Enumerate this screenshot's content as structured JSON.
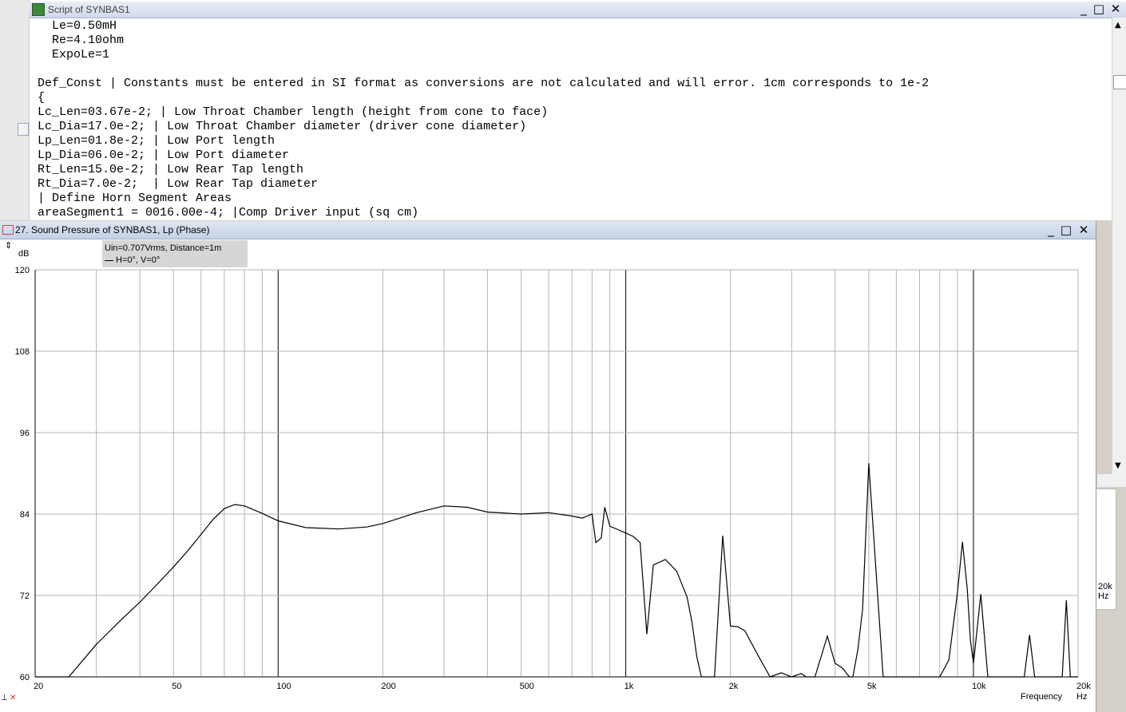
{
  "script_window": {
    "title": "Script of SYNBAS1",
    "lines": [
      "  Le=0.50mH",
      "  Re=4.10ohm",
      "  ExpoLe=1",
      "",
      "Def_Const | Constants must be entered in SI format as conversions are not calculated and will error. 1cm corresponds to 1e-2",
      "{",
      "Lc_Len=03.67e-2; | Low Throat Chamber length (height from cone to face)",
      "Lc_Dia=17.0e-2; | Low Throat Chamber diameter (driver cone diameter)",
      "Lp_Len=01.8e-2; | Low Port length",
      "Lp_Dia=06.0e-2; | Low Port diameter",
      "Rt_Len=15.0e-2; | Low Rear Tap length",
      "Rt_Dia=7.0e-2;  | Low Rear Tap diameter",
      "| Define Horn Segment Areas",
      "areaSegment1 = 0016.00e-4; |Comp Driver input (sq cm)"
    ]
  },
  "behind_window": {
    "axis_label": "20k\nHz"
  },
  "sp_window": {
    "title": "27. Sound Pressure of SYNBAS1, Lp (Phase)",
    "legend_line1": "Uin=0.707Vrms, Distance=1m",
    "legend_line2": "H=0°, V=0°",
    "y_unit": "dB",
    "x_axis_title": "Frequency",
    "x_unit": "Hz"
  },
  "colors": {
    "title_bar": "#cfd9ea",
    "grid_minor": "#b4b4b4",
    "grid_major": "#000000",
    "curve": "#000000",
    "legend_bg": "#d6d6d6"
  },
  "chart_data": {
    "type": "line",
    "x_scale": "log",
    "xlim": [
      20,
      20000
    ],
    "ylim": [
      60,
      120
    ],
    "ylabel": "dB",
    "xlabel": "Frequency",
    "x_unit": "Hz",
    "y_ticks": [
      120,
      108,
      96,
      84,
      72,
      60
    ],
    "x_ticks": [
      {
        "v": 20,
        "label": "20"
      },
      {
        "v": 50,
        "label": "50"
      },
      {
        "v": 100,
        "label": "100"
      },
      {
        "v": 200,
        "label": "200"
      },
      {
        "v": 500,
        "label": "500"
      },
      {
        "v": 1000,
        "label": "1k"
      },
      {
        "v": 2000,
        "label": "2k"
      },
      {
        "v": 5000,
        "label": "5k"
      },
      {
        "v": 10000,
        "label": "10k"
      },
      {
        "v": 20000,
        "label": "20k"
      }
    ],
    "series": [
      {
        "x": [
          20,
          25,
          30,
          35,
          40,
          45,
          50,
          55,
          60,
          65,
          70,
          75,
          80,
          90,
          100,
          120,
          150,
          180,
          200,
          250,
          300,
          350,
          400,
          500,
          600,
          700,
          750,
          800,
          820,
          850,
          870,
          900,
          950,
          1000,
          1050,
          1100,
          1150,
          1200,
          1300,
          1400,
          1500,
          1550,
          1600,
          1650,
          1700,
          1800,
          1900,
          2000,
          2100,
          2200,
          2400,
          2600,
          2800,
          3000,
          3200,
          3300,
          3500,
          3800,
          4000,
          4200,
          4400,
          4500,
          4650,
          4800,
          5000,
          5500,
          6000,
          7000,
          8000,
          8500,
          9000,
          9300,
          9600,
          9800,
          10000,
          10500,
          11000,
          13000,
          14000,
          14500,
          15000,
          17000,
          18000,
          18500,
          19000,
          20000
        ],
        "y": [
          60,
          60,
          64.8,
          68.2,
          71.0,
          73.7,
          76.2,
          78.6,
          81.0,
          83.2,
          84.8,
          85.4,
          85.2,
          84.1,
          83.0,
          82.0,
          81.8,
          82.1,
          82.6,
          84.2,
          85.2,
          85.0,
          84.3,
          84.0,
          84.2,
          83.7,
          83.4,
          84.0,
          79.8,
          80.5,
          85.0,
          82.2,
          81.7,
          81.2,
          80.7,
          79.8,
          66.3,
          76.5,
          77.3,
          75.6,
          71.8,
          68.1,
          63.0,
          60,
          60,
          60,
          80.8,
          67.5,
          67.4,
          66.8,
          63.2,
          60,
          60.6,
          60,
          60.5,
          60,
          60,
          66.0,
          62.0,
          61.3,
          60,
          60,
          64.0,
          70.0,
          91.5,
          60,
          60,
          60,
          60,
          62.5,
          72.5,
          79.9,
          73.0,
          65.5,
          62.0,
          72.2,
          60,
          60,
          60,
          66.2,
          60,
          60,
          60,
          71.3,
          60,
          60
        ]
      }
    ]
  }
}
